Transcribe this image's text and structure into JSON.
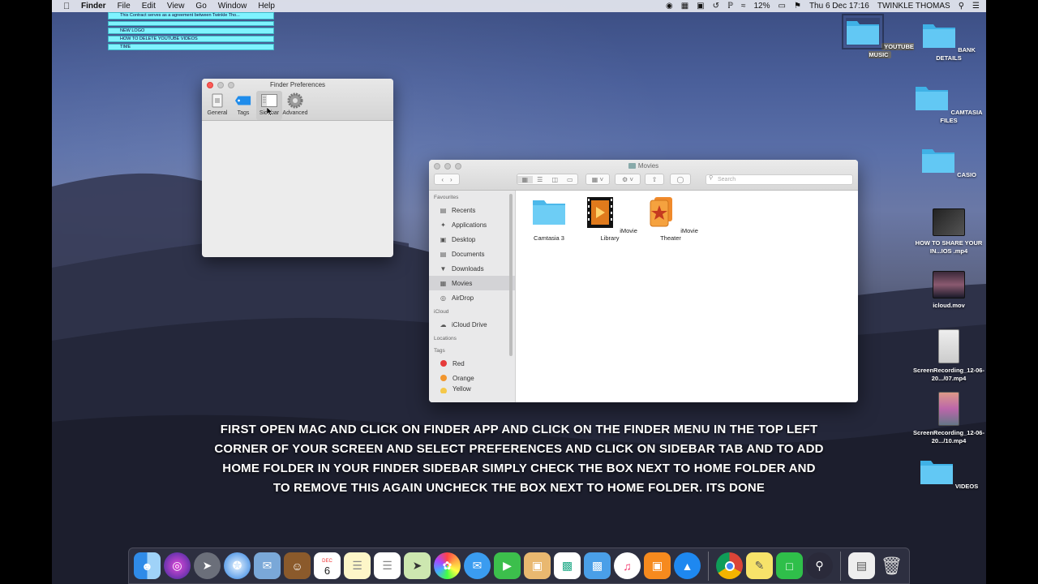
{
  "menubar": {
    "app": "Finder",
    "menus": [
      "File",
      "Edit",
      "View",
      "Go",
      "Window",
      "Help"
    ],
    "battery": "12%",
    "datetime": "Thu 6 Dec  17:16",
    "user": "TWINKLE THOMAS"
  },
  "stickies": {
    "line1": "This Contract serves as a agreement between Twinkle Tho...",
    "line2": "NEW LOGO",
    "line3": "HOW TO DELETE YOUTUBE VIDEOS",
    "line4": "TIME"
  },
  "prefs": {
    "title": "Finder Preferences",
    "tabs": [
      "General",
      "Tags",
      "Sidebar",
      "Advanced"
    ],
    "selected_tab": "Sidebar"
  },
  "finder": {
    "title": "Movies",
    "search_placeholder": "Search",
    "sidebar": {
      "favourites_head": "Favourites",
      "favourites": [
        "Recents",
        "Applications",
        "Desktop",
        "Documents",
        "Downloads",
        "Movies",
        "AirDrop"
      ],
      "icloud_head": "iCloud",
      "icloud": [
        "iCloud Drive"
      ],
      "locations_head": "Locations",
      "tags_head": "Tags",
      "tags": [
        "Red",
        "Orange",
        "Yellow"
      ]
    },
    "items": [
      "Camtasia 3",
      "iMovie Library",
      "iMovie Theater"
    ]
  },
  "desktop": {
    "icons": [
      "YOUTUBE MUSIC",
      "BANK DETAILS",
      "CAMTASIA FILES",
      "CASIO",
      "HOW TO SHARE YOUR IN...IOS .mp4",
      "icloud.mov",
      "ScreenRecording_12-06-20.../07.mp4",
      "ScreenRecording_12-06-20.../10.mp4",
      "VIDEOS"
    ]
  },
  "caption": {
    "line1": "FIRST OPEN MAC AND CLICK ON FINDER APP AND CLICK ON THE FINDER MENU IN THE TOP LEFT",
    "line2": "CORNER OF YOUR SCREEN AND SELECT PREFERENCES AND CLICK ON SIDEBAR TAB AND TO ADD",
    "line3": "HOME FOLDER  IN YOUR FINDER SIDEBAR SIMPLY CHECK THE BOX NEXT TO HOME FOLDER  AND",
    "line4": "TO REMOVE  THIS AGAIN UNCHECK THE BOX NEXT TO HOME FOLDER. ITS DONE"
  },
  "dock": {
    "calendar_month": "DEC",
    "calendar_day": "6"
  },
  "colors": {
    "folder_blue": "#5ac8f5",
    "sticky_cyan": "#7ff3ff",
    "tag_red": "#e63b3b",
    "tag_orange": "#f2962e",
    "tag_yellow": "#f5c84a"
  }
}
